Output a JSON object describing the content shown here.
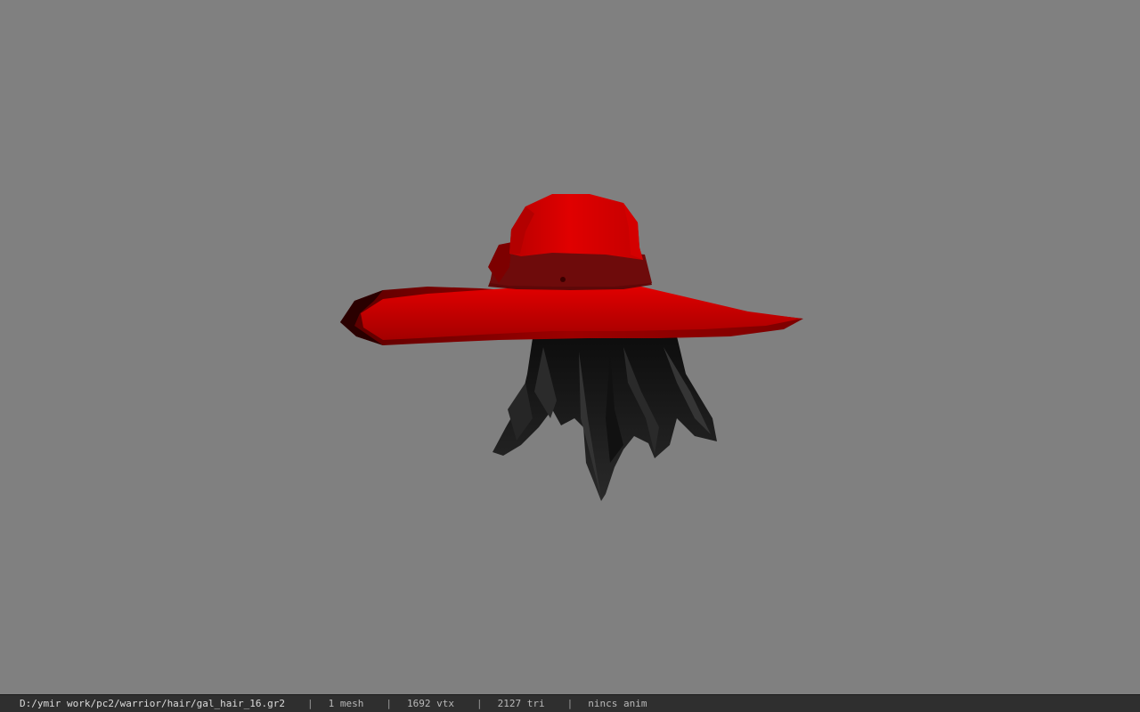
{
  "viewport": {
    "background_color": "#808080",
    "model": {
      "name": "gal_hair_16",
      "hat_color": "#cc0000",
      "hat_band_color": "#6a0a0a",
      "hair_color": "#1f1f1f"
    }
  },
  "status_bar": {
    "file_path": "D:/ymir work/pc2/warrior/hair/gal_hair_16.gr2",
    "separator": "|",
    "mesh_count": "1 mesh",
    "vertex_count": "1692 vtx",
    "triangle_count": "2127 tri",
    "anim_status": "nincs anim"
  }
}
